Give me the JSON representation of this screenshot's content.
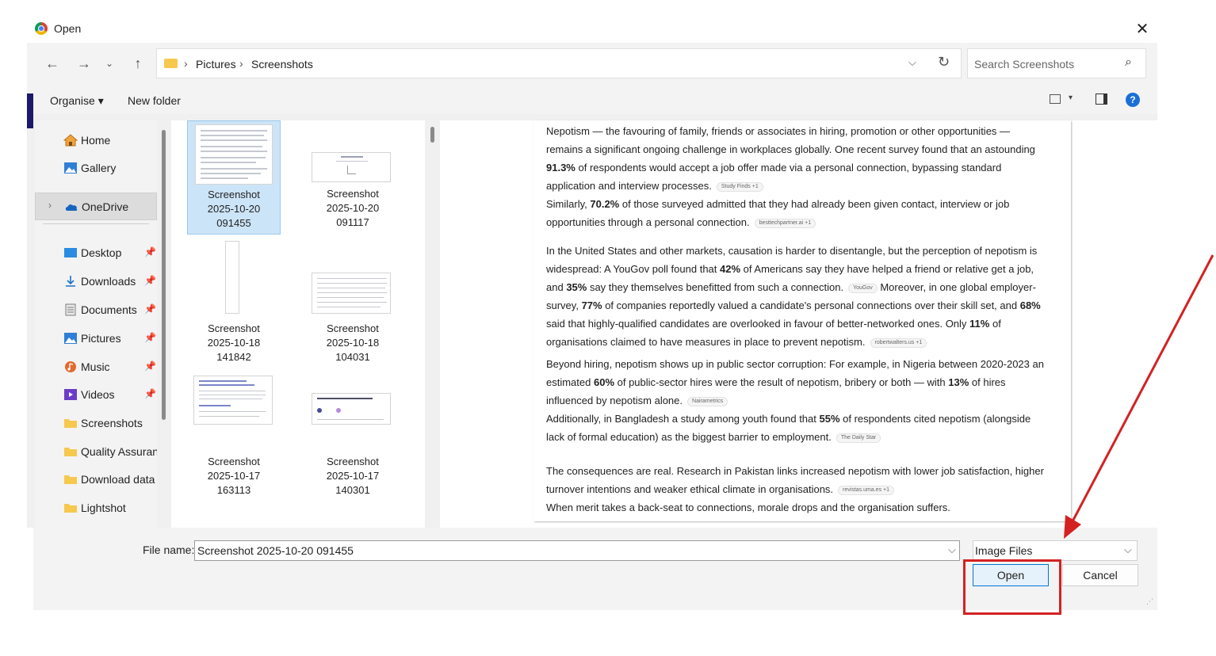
{
  "window": {
    "title": "Open"
  },
  "address_bar": {
    "segments": [
      "Pictures",
      "Screenshots"
    ]
  },
  "search": {
    "placeholder": "Search Screenshots"
  },
  "toolbar": {
    "organise_label": "Organise ▾",
    "new_folder_label": "New folder"
  },
  "sidebar": {
    "items": [
      {
        "label": "Home",
        "icon": "home-icon"
      },
      {
        "label": "Gallery",
        "icon": "gallery-icon"
      },
      {
        "label": "OneDrive",
        "icon": "cloud-icon"
      },
      {
        "label": "Desktop",
        "icon": "desktop-icon"
      },
      {
        "label": "Downloads",
        "icon": "download-icon"
      },
      {
        "label": "Documents",
        "icon": "document-icon"
      },
      {
        "label": "Pictures",
        "icon": "pictures-icon"
      },
      {
        "label": "Music",
        "icon": "music-icon"
      },
      {
        "label": "Videos",
        "icon": "video-icon"
      },
      {
        "label": "Screenshots",
        "icon": "folder-icon"
      },
      {
        "label": "Quality Assuranc",
        "icon": "folder-icon"
      },
      {
        "label": "Download data",
        "icon": "folder-icon"
      },
      {
        "label": "Lightshot",
        "icon": "folder-icon"
      }
    ]
  },
  "files": [
    {
      "line1": "Screenshot",
      "line2": "2025-10-20",
      "line3": "091455"
    },
    {
      "line1": "Screenshot",
      "line2": "2025-10-20",
      "line3": "091117"
    },
    {
      "line1": "Screenshot",
      "line2": "2025-10-18",
      "line3": "141842"
    },
    {
      "line1": "Screenshot",
      "line2": "2025-10-18",
      "line3": "104031"
    },
    {
      "line1": "Screenshot",
      "line2": "2025-10-17",
      "line3": "163113"
    },
    {
      "line1": "Screenshot",
      "line2": "2025-10-17",
      "line3": "140301"
    }
  ],
  "preview": {
    "p1": {
      "a": "Nepotism — the favouring of family, friends or associates in hiring, promotion or other opportunities — remains a significant ongoing challenge in workplaces globally. One recent survey found that an astounding ",
      "b1": "91.3%",
      "c": " of respondents would accept a job offer made via a personal connection, bypassing standard application and interview processes.",
      "chip1": "Study Finds +1",
      "d": "Similarly, ",
      "b2": "70.2%",
      "e": " of those surveyed admitted that they had already been given contact, interview or job opportunities through a personal connection.",
      "chip2": "besttechpartner.ai +1"
    },
    "p2": {
      "a": "In the United States and other markets, causation is harder to disentangle, but the perception of nepotism is widespread: A YouGov poll found that ",
      "b1": "42%",
      "c": " of Americans say they have helped a friend or relative get a job, and ",
      "b2": "35%",
      "d": " say they themselves benefitted from such a connection.",
      "chip1": "YouGov",
      "e": " Moreover, in one global employer-survey, ",
      "b3": "77%",
      "f": " of companies reportedly valued a candidate's personal connections over their skill set, and ",
      "b4": "68%",
      "g": " said that highly-qualified candidates are overlooked in favour of better-networked ones. Only ",
      "b5": "11%",
      "h": " of organisations claimed to have measures in place to prevent nepotism.",
      "chip2": "robertwalters.us +1"
    },
    "p3": {
      "a": "Beyond hiring, nepotism shows up in public sector corruption: For example, in Nigeria between 2020-2023 an estimated ",
      "b1": "60%",
      "c": " of public-sector hires were the result of nepotism, bribery or both — with ",
      "b2": "13%",
      "d": " of hires influenced by nepotism alone.",
      "chip1": "Nairametrics",
      "e": "Additionally, in Bangladesh a study among youth found that ",
      "b3": "55%",
      "f": " of respondents cited nepotism (alongside lack of formal education) as the biggest barrier to employment.",
      "chip2": "The Daily Star"
    },
    "p4": {
      "a": "The consequences are real. Research in Pakistan links increased nepotism with lower job satisfaction, higher turnover intentions and weaker ethical climate in organisations.",
      "chip1": "revistas.uma.es +1",
      "b": "When merit takes a back-seat to connections, morale drops and the organisation suffers."
    }
  },
  "bottom": {
    "file_name_label": "File name:",
    "file_name_value": "Screenshot 2025-10-20 091455",
    "file_type_value": "Image Files",
    "open_label": "Open",
    "cancel_label": "Cancel"
  },
  "colors": {
    "accent": "#0078d4",
    "annotation": "#d32222",
    "selection": "#cce4f7"
  }
}
